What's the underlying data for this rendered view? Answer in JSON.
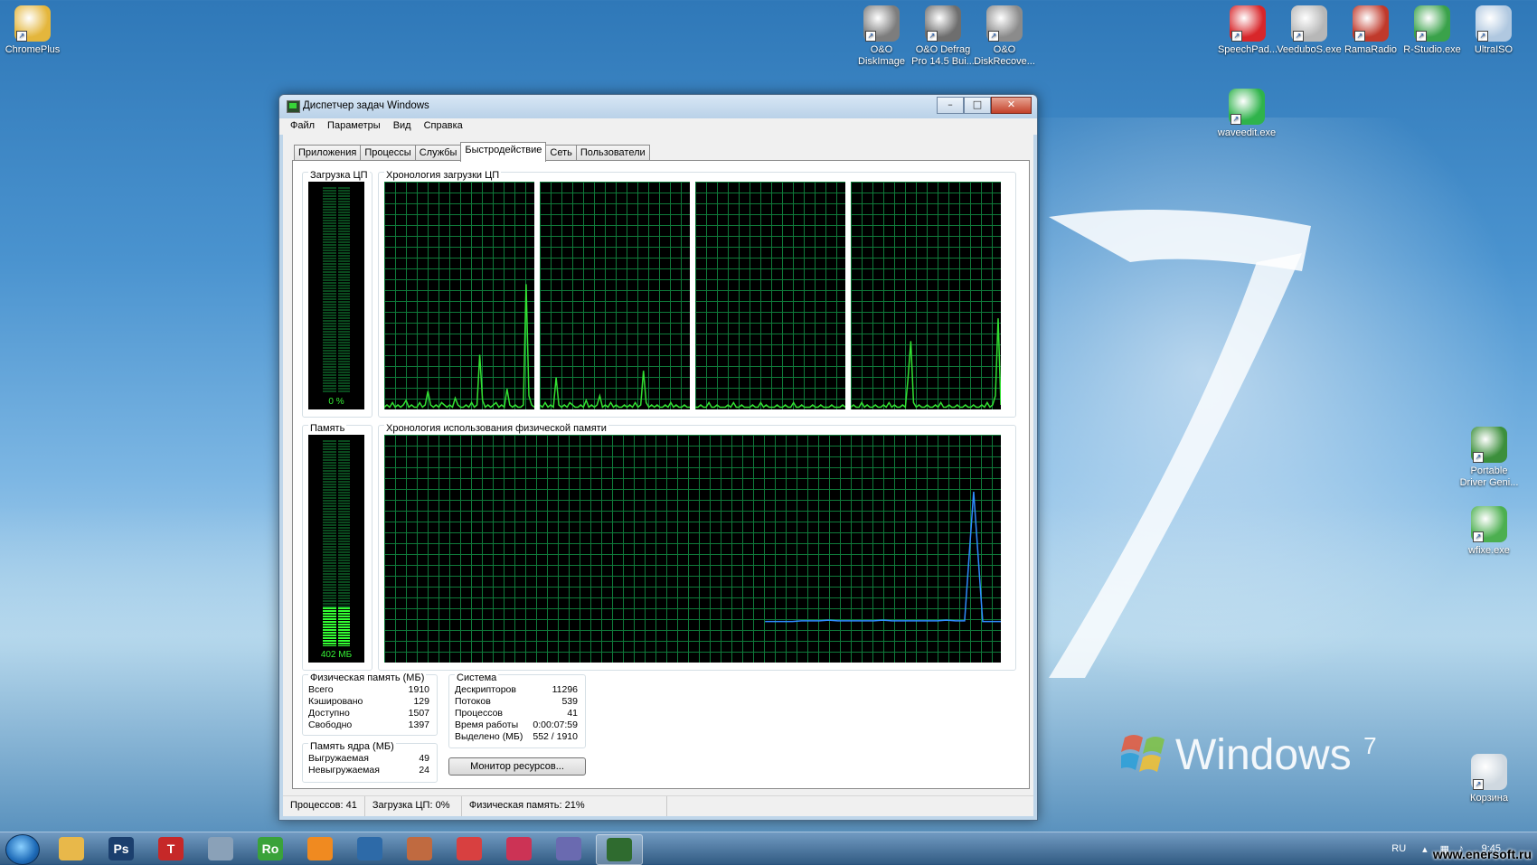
{
  "desktop": {
    "icons_left": [
      {
        "label": "ChromePlus",
        "color": "#e4b63c"
      }
    ],
    "icons_top": [
      {
        "label": "O&O DiskImage",
        "color": "#7d7d7d"
      },
      {
        "label": "O&O Defrag Pro 14.5 Bui...",
        "color": "#6e6e6e"
      },
      {
        "label": "O&O DiskRecove...",
        "color": "#8b8b8b"
      }
    ],
    "icons_right_top": [
      {
        "label": "SpeechPad...",
        "color": "#d8262a"
      },
      {
        "label": "VeeduboS.exe",
        "color": "#b7b7b7"
      },
      {
        "label": "RamaRadio",
        "color": "#c0392b"
      },
      {
        "label": "R-Studio.exe",
        "color": "#3aa24a"
      },
      {
        "label": "UltraISO",
        "color": "#b0c8e0"
      }
    ],
    "icons_right": [
      {
        "label": "waveedit.exe",
        "color": "#2fb34b"
      },
      {
        "label": "Portable Driver Geni...",
        "color": "#3c8f3c"
      },
      {
        "label": "wfixe.exe",
        "color": "#4caf50"
      },
      {
        "label": "Корзина",
        "color": "#cfd8e0"
      }
    ],
    "brand": "Windows",
    "brand_version": "7"
  },
  "window": {
    "title": "Диспетчер задач Windows",
    "minimize": "–",
    "maximize": "□",
    "close": "✕",
    "menu": [
      "Файл",
      "Параметры",
      "Вид",
      "Справка"
    ],
    "tabs": [
      "Приложения",
      "Процессы",
      "Службы",
      "Быстродействие",
      "Сеть",
      "Пользователи"
    ],
    "active_tab": "Быстродействие",
    "cpu_usage_label": "Загрузка ЦП",
    "cpu_usage_value": "0 %",
    "cpu_usage_fraction": 0.0,
    "cpu_history_label": "Хронология загрузки ЦП",
    "memory_label": "Память",
    "memory_value": "402 МБ",
    "memory_fraction": 0.21,
    "memory_history_label": "Хронология использования физической памяти",
    "physical_memory": {
      "title": "Физическая память (МБ)",
      "rows": [
        {
          "label": "Всего",
          "value": "1910"
        },
        {
          "label": "Кэшировано",
          "value": "129"
        },
        {
          "label": "Доступно",
          "value": "1507"
        },
        {
          "label": "Свободно",
          "value": "1397"
        }
      ]
    },
    "kernel_memory": {
      "title": "Память ядра (МБ)",
      "rows": [
        {
          "label": "Выгружаемая",
          "value": "49"
        },
        {
          "label": "Невыгружаемая",
          "value": "24"
        }
      ]
    },
    "system": {
      "title": "Система",
      "rows": [
        {
          "label": "Дескрипторов",
          "value": "11296"
        },
        {
          "label": "Потоков",
          "value": "539"
        },
        {
          "label": "Процессов",
          "value": "41"
        },
        {
          "label": "Время работы",
          "value": "0:00:07:59"
        },
        {
          "label": "Выделено (МБ)",
          "value": "552 / 1910"
        }
      ]
    },
    "resource_monitor_button": "Монитор ресурсов...",
    "status": {
      "processes": "Процессов: 41",
      "cpu": "Загрузка ЦП: 0%",
      "memory": "Физическая память: 21%"
    }
  },
  "taskbar": {
    "apps": [
      {
        "name": "explorer",
        "label": "",
        "color": "#e8b84a"
      },
      {
        "name": "photoshop",
        "label": "Ps",
        "color": "#1b3f6e"
      },
      {
        "name": "t-app",
        "label": "T",
        "color": "#c62828"
      },
      {
        "name": "tools",
        "label": "",
        "color": "#8aa1b8"
      },
      {
        "name": "ro-app",
        "label": "Ro",
        "color": "#3aa23a"
      },
      {
        "name": "flower",
        "label": "",
        "color": "#f08a20"
      },
      {
        "name": "x-app",
        "label": "",
        "color": "#2d6aa8"
      },
      {
        "name": "calc",
        "label": "",
        "color": "#c06a40"
      },
      {
        "name": "chrome",
        "label": "",
        "color": "#d84040"
      },
      {
        "name": "browser",
        "label": "",
        "color": "#cc3355"
      },
      {
        "name": "qip",
        "label": "",
        "color": "#6a6ab0"
      },
      {
        "name": "task-manager",
        "label": "",
        "color": "#2f6b2f"
      }
    ],
    "lang": "RU",
    "time": "9:45",
    "watermark": "www.enersoft.ru"
  },
  "chart_data": [
    {
      "type": "line",
      "series": [
        {
          "values": [
            1,
            2,
            1,
            3,
            1,
            2,
            1,
            2,
            4,
            1,
            2,
            1,
            1,
            3,
            1,
            2,
            8,
            2,
            1,
            2,
            1,
            3,
            2,
            1,
            2,
            1,
            5,
            2,
            1,
            1,
            2,
            1,
            3,
            1,
            2,
            24,
            4,
            1,
            2,
            1,
            2,
            3,
            1,
            2,
            1,
            9,
            2,
            1,
            2,
            1,
            1,
            2,
            55,
            6,
            2,
            1
          ]
        },
        {
          "values": [
            2,
            1,
            3,
            1,
            2,
            1,
            14,
            2,
            1,
            2,
            1,
            3,
            2,
            1,
            1,
            2,
            1,
            4,
            1,
            2,
            1,
            2,
            6,
            1,
            2,
            1,
            3,
            1,
            2,
            1,
            1,
            2,
            1,
            2,
            1,
            3,
            1,
            2,
            17,
            3,
            1,
            2,
            1,
            2,
            1,
            1,
            2,
            1,
            3,
            1,
            2,
            1,
            1,
            2,
            1,
            1
          ]
        },
        {
          "values": [
            1,
            1,
            2,
            1,
            1,
            3,
            1,
            1,
            2,
            1,
            1,
            1,
            2,
            1,
            3,
            1,
            1,
            2,
            1,
            1,
            1,
            2,
            1,
            1,
            3,
            1,
            2,
            1,
            1,
            1,
            2,
            1,
            1,
            2,
            1,
            1,
            3,
            1,
            1,
            2,
            1,
            1,
            1,
            2,
            1,
            1,
            2,
            1,
            1,
            1,
            2,
            1,
            1,
            1,
            2,
            1
          ]
        },
        {
          "values": [
            1,
            2,
            1,
            1,
            3,
            1,
            2,
            1,
            1,
            2,
            1,
            1,
            2,
            1,
            3,
            1,
            2,
            1,
            1,
            2,
            1,
            14,
            30,
            3,
            1,
            2,
            1,
            1,
            2,
            1,
            1,
            2,
            1,
            3,
            1,
            1,
            2,
            1,
            1,
            2,
            1,
            1,
            2,
            1,
            1,
            2,
            1,
            1,
            2,
            1,
            3,
            1,
            2,
            6,
            40,
            2
          ]
        }
      ]
    },
    {
      "type": "line",
      "series": [
        {
          "values": [
            null,
            null,
            null,
            null,
            null,
            null,
            null,
            null,
            null,
            null,
            null,
            null,
            null,
            null,
            null,
            null,
            null,
            null,
            null,
            null,
            null,
            null,
            null,
            null,
            null,
            null,
            null,
            null,
            null,
            null,
            null,
            null,
            null,
            null,
            null,
            null,
            null,
            null,
            null,
            null,
            null,
            null,
            18,
            18,
            18,
            18,
            18.3,
            18.3,
            18.3,
            18.6,
            18.3,
            18.3,
            18.3,
            18.3,
            18.3,
            18.6,
            18.3,
            18.3,
            18.3,
            18.3,
            18.3,
            18.3,
            18.6,
            18.3,
            18.3,
            75,
            18,
            18,
            18
          ]
        }
      ]
    }
  ]
}
